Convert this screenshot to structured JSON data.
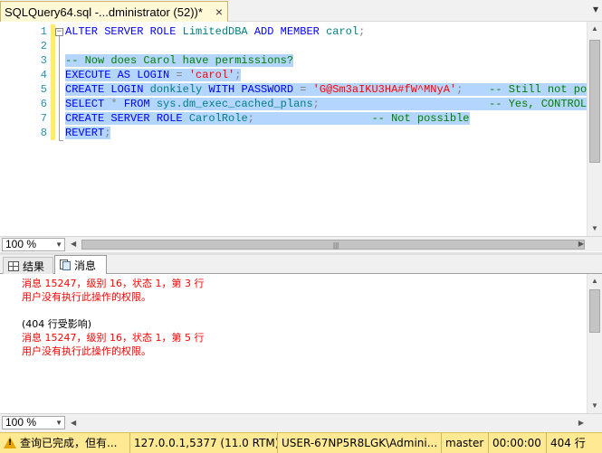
{
  "document_tab": {
    "title": "SQLQuery64.sql -...dministrator (52))*",
    "close_glyph": "×",
    "menu_glyph": "▾"
  },
  "editor": {
    "line_numbers": [
      "1",
      "2",
      "3",
      "4",
      "5",
      "6",
      "7",
      "8"
    ],
    "lines": [
      [
        {
          "cls": "kw",
          "text": "ALTER SERVER ROLE "
        },
        {
          "cls": "id",
          "text": "LimitedDBA "
        },
        {
          "cls": "kw",
          "text": "ADD MEMBER "
        },
        {
          "cls": "id",
          "text": "carol"
        },
        {
          "cls": "op",
          "text": ";"
        }
      ],
      [],
      [
        {
          "cls": "cm",
          "text": "-- Now does Carol have permissions?"
        }
      ],
      [
        {
          "cls": "kw",
          "text": "EXECUTE AS LOGIN "
        },
        {
          "cls": "op",
          "text": "= "
        },
        {
          "cls": "str",
          "text": "'carol'"
        },
        {
          "cls": "op",
          "text": ";"
        }
      ],
      [
        {
          "cls": "kw",
          "text": "CREATE LOGIN "
        },
        {
          "cls": "id",
          "text": "donkiely "
        },
        {
          "cls": "kw",
          "text": "WITH PASSWORD "
        },
        {
          "cls": "op",
          "text": "= "
        },
        {
          "cls": "str",
          "text": "'G@Sm3aIKU3HA#fW^MNyA'"
        },
        {
          "cls": "op",
          "text": ";"
        },
        {
          "cls": "",
          "text": "    "
        },
        {
          "cls": "cm",
          "text": "-- Still not poss"
        }
      ],
      [
        {
          "cls": "kw",
          "text": "SELECT "
        },
        {
          "cls": "op",
          "text": "* "
        },
        {
          "cls": "kw",
          "text": "FROM "
        },
        {
          "cls": "id",
          "text": "sys.dm_exec_cached_plans"
        },
        {
          "cls": "op",
          "text": ";"
        },
        {
          "cls": "",
          "text": "                          "
        },
        {
          "cls": "cm",
          "text": "-- Yes, CONTROL"
        }
      ],
      [
        {
          "cls": "kw",
          "text": "CREATE SERVER ROLE "
        },
        {
          "cls": "id",
          "text": "CarolRole"
        },
        {
          "cls": "op",
          "text": ";"
        },
        {
          "cls": "",
          "text": "                  "
        },
        {
          "cls": "cm",
          "text": "-- Not possible"
        }
      ],
      [
        {
          "cls": "kw",
          "text": "REVERT"
        },
        {
          "cls": "op",
          "text": ";"
        }
      ]
    ]
  },
  "zoom": {
    "editor_value": "100 %",
    "messages_value": "100 %"
  },
  "result_tabs": {
    "results_label": "结果",
    "messages_label": "消息"
  },
  "messages": [
    {
      "type": "err",
      "text": "消息 15247，级别 16，状态 1，第 3 行"
    },
    {
      "type": "err",
      "text": "用户没有执行此操作的权限。"
    },
    {
      "type": "blank",
      "text": ""
    },
    {
      "type": "info",
      "text": "(404 行受影响)"
    },
    {
      "type": "err",
      "text": "消息 15247，级别 16，状态 1，第 5 行"
    },
    {
      "type": "err",
      "text": "用户没有执行此操作的权限。"
    }
  ],
  "status_bar": {
    "status_text": "查询已完成，但有...",
    "server": "127.0.0.1,5377 (11.0 RTM)",
    "user": "USER-67NP5R8LGK\\Admini...",
    "database": "master",
    "elapsed": "00:00:00",
    "rows": "404 行"
  }
}
